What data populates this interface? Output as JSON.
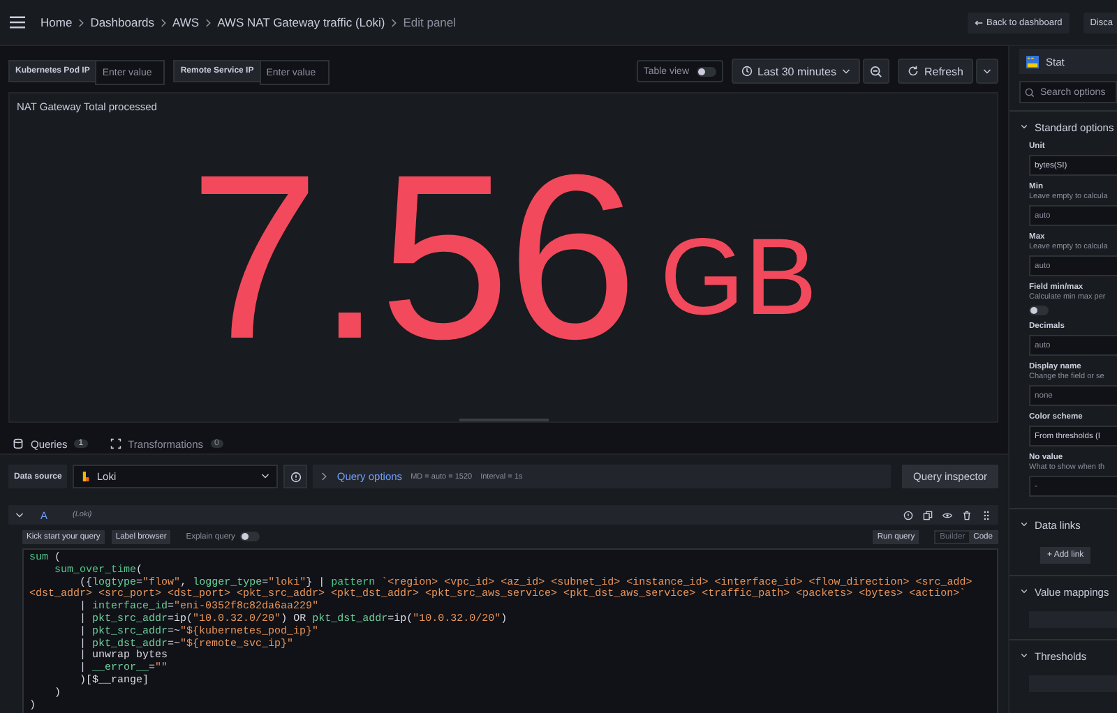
{
  "breadcrumbs": [
    {
      "label": "Home",
      "current": false
    },
    {
      "label": "Dashboards",
      "current": false
    },
    {
      "label": "AWS",
      "current": false
    },
    {
      "label": "AWS NAT Gateway traffic (Loki)",
      "current": false
    },
    {
      "label": "Edit panel",
      "current": true
    }
  ],
  "header_buttons": [
    "Back to dashboard",
    "Disca"
  ],
  "variables": [
    {
      "label": "Kubernetes Pod IP",
      "placeholder": "Enter value"
    },
    {
      "label": "Remote Service IP",
      "placeholder": "Enter value"
    }
  ],
  "table_view": {
    "label": "Table view",
    "on": false
  },
  "time_range": "Last 30 minutes",
  "refresh": "Refresh",
  "panel": {
    "title": "NAT Gateway Total processed",
    "value": "7.56",
    "unit": "GB"
  },
  "query_tabs": [
    {
      "label": "Queries",
      "count": "1",
      "selected": true
    },
    {
      "label": "Transformations",
      "count": "0",
      "selected": false
    }
  ],
  "datasource": {
    "label": "Data source",
    "value": "Loki"
  },
  "query_options": {
    "label": "Query options",
    "md": "MD = auto = 1520",
    "interval": "Interval = 1s"
  },
  "query_inspector": "Query inspector",
  "query": {
    "ref": "A",
    "source": "(Loki)",
    "expanded": true
  },
  "editor_buttons": [
    "Kick start your query",
    "Label browser"
  ],
  "explain": {
    "label": "Explain query",
    "on": false
  },
  "run_query": "Run query",
  "modes": [
    {
      "label": "Builder",
      "selected": false
    },
    {
      "label": "Code",
      "selected": true
    }
  ],
  "code": [
    {
      "tokens": [
        {
          "kind": "function",
          "text": "sum"
        },
        {
          "kind": "plain",
          "text": " ("
        }
      ],
      "children": [
        {
          "tokens": [
            {
              "kind": "function",
              "text": "sum_over_time"
            },
            {
              "kind": "plain",
              "text": "("
            }
          ],
          "children": [
            {
              "tokens": [
                {
                  "kind": "plain",
                  "text": "({"
                },
                {
                  "kind": "label",
                  "text": "logtype"
                },
                {
                  "kind": "plain",
                  "text": "="
                },
                {
                  "kind": "string",
                  "text": "\"flow\""
                },
                {
                  "kind": "plain",
                  "text": ", "
                },
                {
                  "kind": "label",
                  "text": "logger_type"
                },
                {
                  "kind": "plain",
                  "text": "="
                },
                {
                  "kind": "string",
                  "text": "\"loki\""
                },
                {
                  "kind": "plain",
                  "text": "} | "
                },
                {
                  "kind": "function",
                  "text": "pattern"
                },
                {
                  "kind": "string",
                  "text": " `<region> <vpc_id> <az_id> <subnet_id> <instance_id> <interface_id> <flow_direction> <src_add> <dst_addr> <src_port> <dst_port> <pkt_src_addr> <pkt_dst_addr> <pkt_src_aws_service> <pkt_dst_aws_service> <traffic_path> <packets> <bytes> <action>`"
                }
              ]
            },
            {
              "tokens": [
                {
                  "kind": "plain",
                  "text": "| "
                },
                {
                  "kind": "label",
                  "text": "interface_id"
                },
                {
                  "kind": "plain",
                  "text": "="
                },
                {
                  "kind": "string",
                  "text": "\"eni-0352f8c82da6aa229\""
                }
              ]
            },
            {
              "tokens": [
                {
                  "kind": "plain",
                  "text": "| "
                },
                {
                  "kind": "label",
                  "text": "pkt_src_addr"
                },
                {
                  "kind": "plain",
                  "text": "=ip("
                },
                {
                  "kind": "string",
                  "text": "\"10.0.32.0/20\""
                },
                {
                  "kind": "plain",
                  "text": ") OR "
                },
                {
                  "kind": "label",
                  "text": "pkt_dst_addr"
                },
                {
                  "kind": "plain",
                  "text": "=ip("
                },
                {
                  "kind": "string",
                  "text": "\"10.0.32.0/20\""
                },
                {
                  "kind": "plain",
                  "text": ")"
                }
              ]
            },
            {
              "tokens": [
                {
                  "kind": "plain",
                  "text": "| "
                },
                {
                  "kind": "label",
                  "text": "pkt_src_addr"
                },
                {
                  "kind": "plain",
                  "text": "=~"
                },
                {
                  "kind": "string",
                  "text": "\"${kubernetes_pod_ip}\""
                }
              ]
            },
            {
              "tokens": [
                {
                  "kind": "plain",
                  "text": "| "
                },
                {
                  "kind": "label",
                  "text": "pkt_dst_addr"
                },
                {
                  "kind": "plain",
                  "text": "=~"
                },
                {
                  "kind": "string",
                  "text": "\"${remote_svc_ip}\""
                }
              ]
            },
            {
              "tokens": [
                {
                  "kind": "plain",
                  "text": "| unwrap bytes"
                }
              ]
            },
            {
              "tokens": [
                {
                  "kind": "plain",
                  "text": "| "
                },
                {
                  "kind": "label",
                  "text": "__error__"
                },
                {
                  "kind": "plain",
                  "text": "="
                },
                {
                  "kind": "string",
                  "text": "\"\""
                }
              ]
            },
            {
              "tokens": [
                {
                  "kind": "plain",
                  "text": ")[$__range]"
                }
              ]
            }
          ]
        },
        {
          "tokens": [
            {
              "kind": "plain",
              "text": ")"
            }
          ]
        }
      ]
    },
    {
      "tokens": [
        {
          "kind": "plain",
          "text": ")"
        }
      ]
    }
  ],
  "options": {
    "visualization": "Stat",
    "search_placeholder": "Search options",
    "sections": [
      {
        "title": "Standard options",
        "expanded": true,
        "fields": [
          {
            "kind": "input",
            "label": "Unit",
            "value": "bytes(SI)"
          },
          {
            "kind": "input",
            "label": "Min",
            "description": "Leave empty to calcula",
            "placeholder": "auto"
          },
          {
            "kind": "input",
            "label": "Max",
            "description": "Leave empty to calcula",
            "placeholder": "auto"
          },
          {
            "kind": "switch",
            "label": "Field min/max",
            "description": "Calculate min max per",
            "on": false
          },
          {
            "kind": "input",
            "label": "Decimals",
            "placeholder": "auto"
          },
          {
            "kind": "input",
            "label": "Display name",
            "description": "Change the field or se",
            "placeholder": "none"
          },
          {
            "kind": "input",
            "label": "Color scheme",
            "value": "From thresholds (I"
          },
          {
            "kind": "input",
            "label": "No value",
            "description": "What to show when th",
            "placeholder": "-"
          }
        ]
      },
      {
        "title": "Data links",
        "expanded": true,
        "button": "+ Add link"
      },
      {
        "title": "Value mappings",
        "expanded": true,
        "bar": true
      },
      {
        "title": "Thresholds",
        "expanded": true,
        "bar": true
      }
    ]
  }
}
